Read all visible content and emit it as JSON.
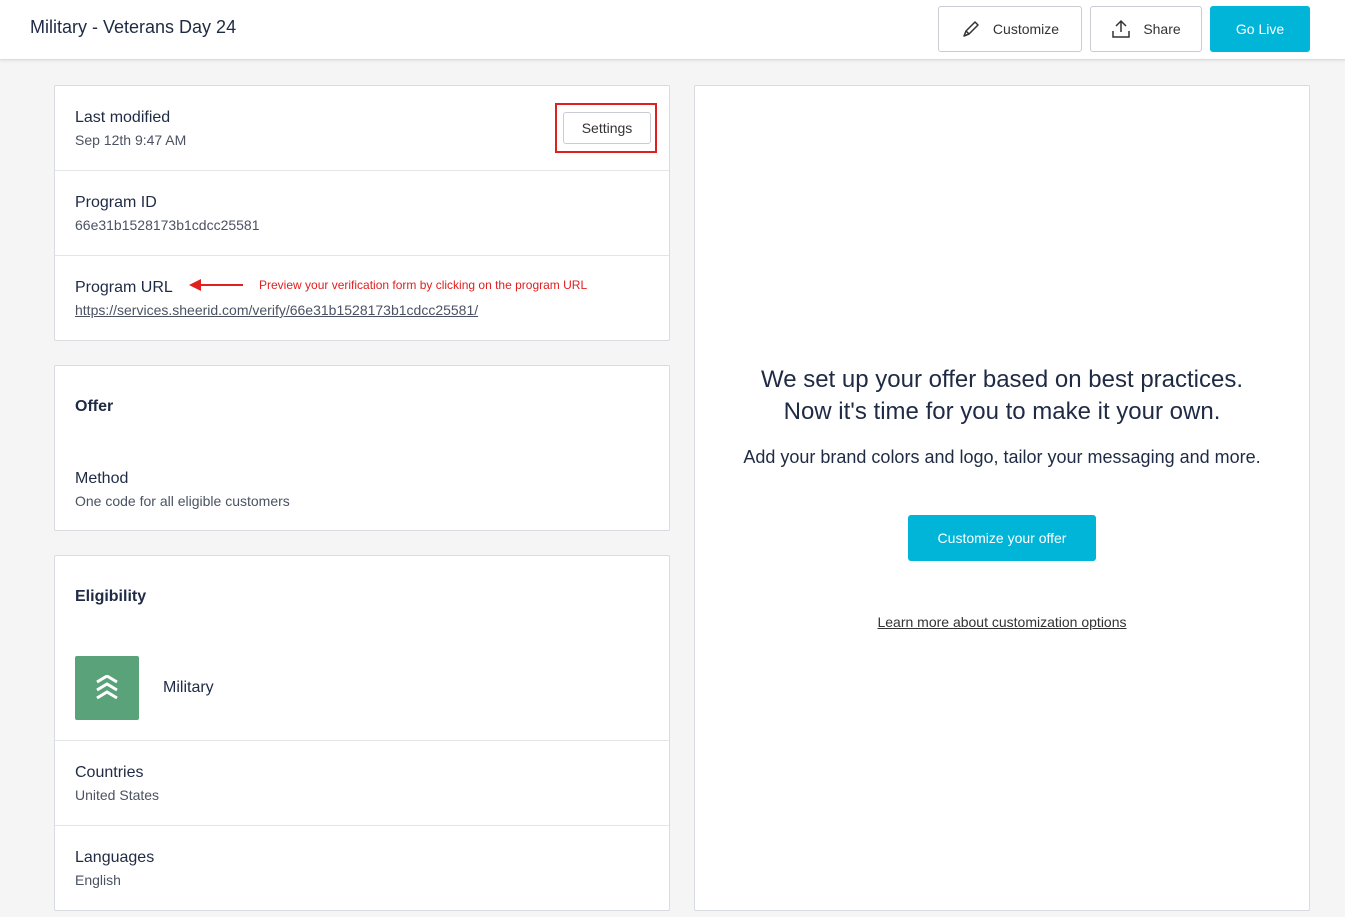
{
  "header": {
    "title": "Military - Veterans Day 24",
    "customize_label": "Customize",
    "share_label": "Share",
    "go_live_label": "Go Live"
  },
  "info_card": {
    "last_modified_label": "Last modified",
    "last_modified_value": "Sep 12th 9:47 AM",
    "settings_label": "Settings",
    "program_id_label": "Program ID",
    "program_id_value": "66e31b1528173b1cdcc25581",
    "program_url_label": "Program URL",
    "program_url_value": "https://services.sheerid.com/verify/66e31b1528173b1cdcc25581/",
    "annotation": "Preview your verification form by clicking on the program URL"
  },
  "offer_card": {
    "offer_label": "Offer",
    "method_label": "Method",
    "method_value": "One code for all eligible customers"
  },
  "eligibility_card": {
    "eligibility_label": "Eligibility",
    "segment_label": "Military",
    "segment_icon": "military-chevrons-icon",
    "countries_label": "Countries",
    "countries_value": "United States",
    "languages_label": "Languages",
    "languages_value": "English"
  },
  "preview": {
    "headline_line1": "We set up your offer based on best practices.",
    "headline_line2": "Now it's time for you to make it your own.",
    "subtext": "Add your brand colors and logo, tailor your messaging and more.",
    "customize_offer_label": "Customize your offer",
    "learn_more_label": "Learn more about customization options"
  },
  "colors": {
    "accent": "#00b5d8",
    "annotation": "#e01f1f",
    "military_green": "#5aa27a"
  }
}
